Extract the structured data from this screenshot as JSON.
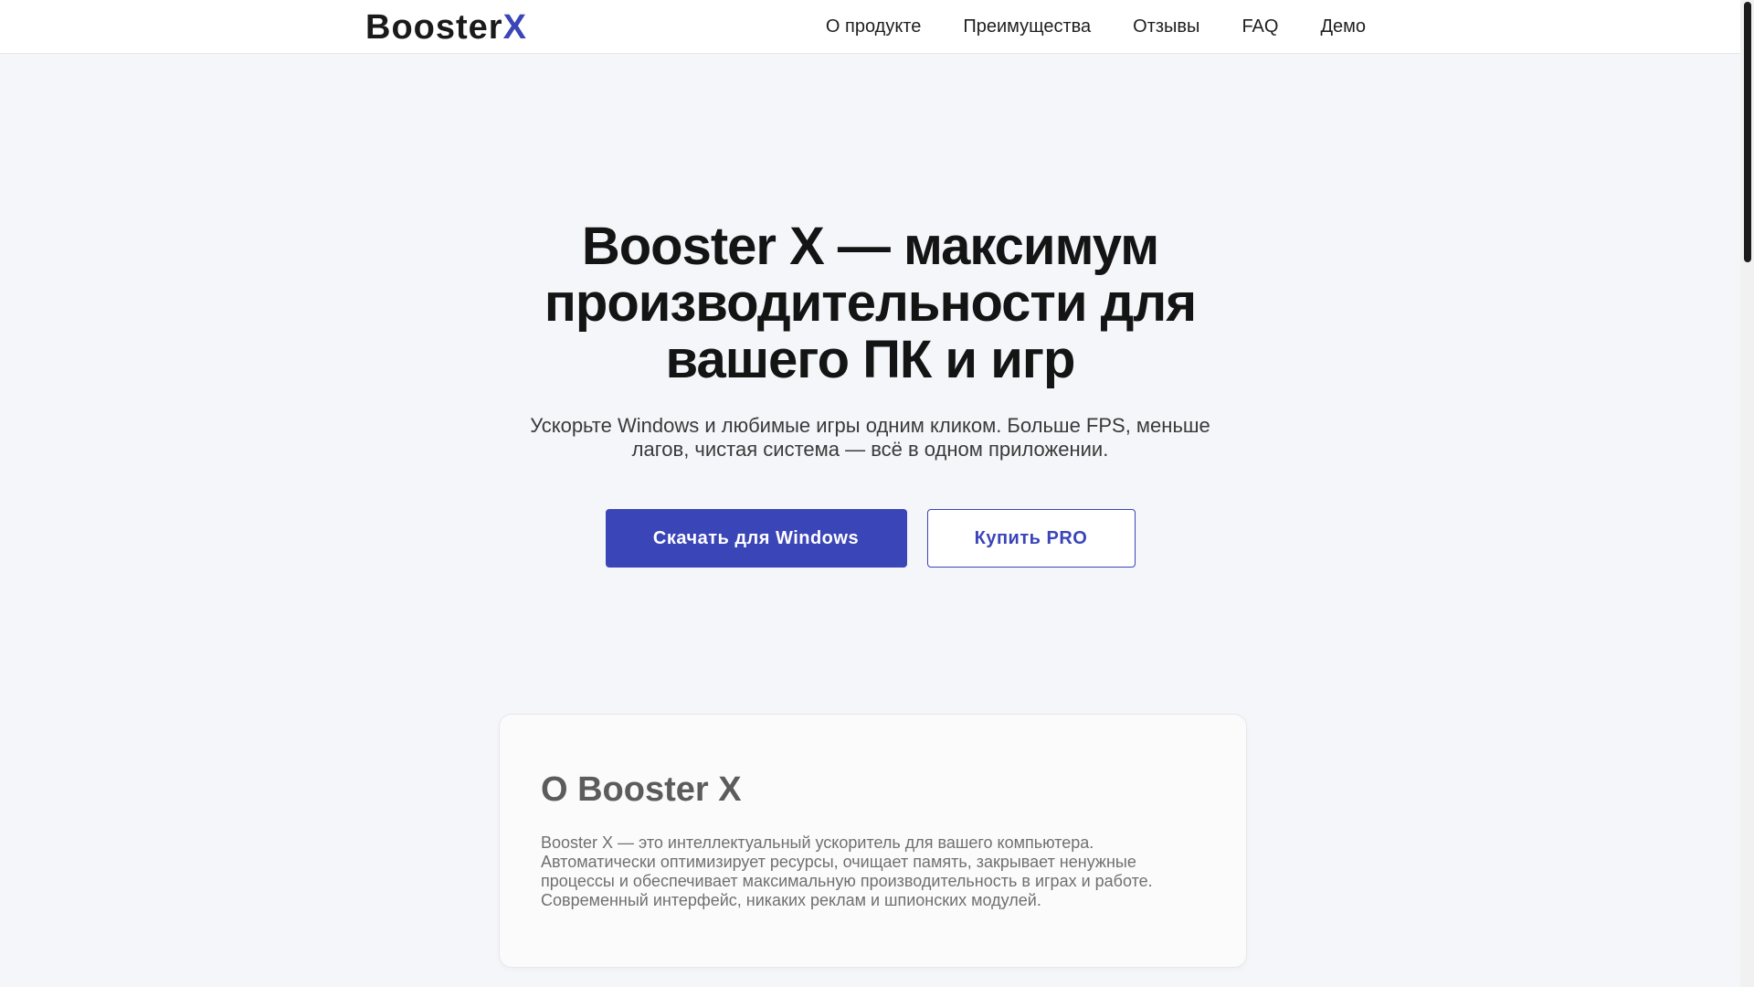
{
  "header": {
    "logo_main": "Booster",
    "logo_accent": "X",
    "nav": [
      {
        "label": "О продукте"
      },
      {
        "label": "Преимущества"
      },
      {
        "label": "Отзывы"
      },
      {
        "label": "FAQ"
      },
      {
        "label": "Демо"
      }
    ]
  },
  "hero": {
    "title": "Booster X — максимум производительности для вашего ПК и игр",
    "subtitle": "Ускорьте Windows и любимые игры одним кликом. Больше FPS, меньше лагов, чистая система — всё в одном приложении.",
    "primary_button": "Скачать для Windows",
    "secondary_button": "Купить PRO"
  },
  "about": {
    "title": "О Booster X",
    "text": "Booster X — это интеллектуальный ускоритель для вашего компьютера. Автоматически оптимизирует ресурсы, очищает память, закрывает ненужные процессы и обеспечивает максимальную производительность в играх и работе. Современный интерфейс, никаких реклам и шпионских модулей."
  },
  "colors": {
    "accent": "#3a45b8",
    "background": "#f5f6fa",
    "header_bg": "#ffffff"
  }
}
